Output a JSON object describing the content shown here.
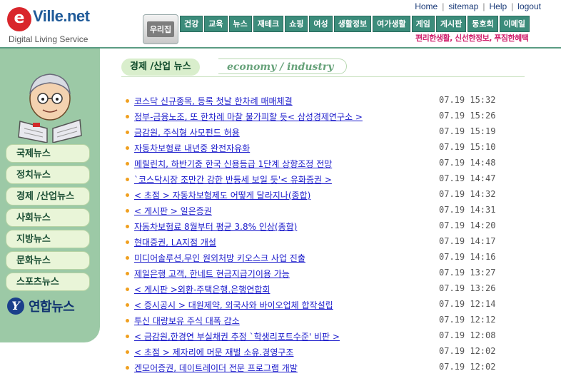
{
  "logo": {
    "e": "e",
    "name": "Ville.net",
    "tagline": "Digital Living Service"
  },
  "top_links": [
    "Home",
    "sitemap",
    "Help",
    "logout"
  ],
  "home_tab": "우리집",
  "nav_items": [
    "건강",
    "교육",
    "뉴스",
    "재테크",
    "쇼핑",
    "여성",
    "생활정보",
    "여가생활",
    "게임",
    "게시판",
    "동호회",
    "이메일"
  ],
  "slogan": "편리한생활, 신선한정보, 푸짐한혜택",
  "sidebar": {
    "items": [
      "국제뉴스",
      "정치뉴스",
      "경제 /산업뉴스",
      "사회뉴스",
      "지방뉴스",
      "문화뉴스",
      "스포츠뉴스"
    ],
    "brand": "연합뉴스"
  },
  "section": {
    "title_ko": "경제 /산업 뉴스",
    "title_en": "economy / industry"
  },
  "colors": {
    "accent": "#3c8c7b",
    "sidebar": "#9cc9a6",
    "link": "#1a1acb",
    "bullet": "#f0a020"
  },
  "news": [
    {
      "title": "코스닥 신규종목, 등록 첫날 한차례 매매체결",
      "time": "07.19 15:32"
    },
    {
      "title": "정부-금융노조, 또 한차례 마찰 불가피할 듯< 삼성경제연구소 >",
      "time": "07.19 15:26"
    },
    {
      "title": "금감원, 주식형 사모펀드 허용",
      "time": "07.19 15:19"
    },
    {
      "title": "자동차보험료 내년중 완전자유화",
      "time": "07.19 15:10"
    },
    {
      "title": "메릴린치, 하반기중 한국 신용등급 1단계 상향조정 전망",
      "time": "07.19 14:48"
    },
    {
      "title": "`코스닥시장 조만간 강한 반등세 보일 듯'< 유화증권 >",
      "time": "07.19 14:47"
    },
    {
      "title": "< 초점 > 자동차보험제도 어떻게 달라지나(종합)",
      "time": "07.19 14:32"
    },
    {
      "title": "< 게시판 > 일은증권",
      "time": "07.19 14:31"
    },
    {
      "title": "자동차보험료 8월부터 평균 3.8% 인상(종합)",
      "time": "07.19 14:20"
    },
    {
      "title": "현대증권, LA지점 개설",
      "time": "07.19 14:17"
    },
    {
      "title": "미디어솔루션,무인 원외처방 키오스크 사업 진출",
      "time": "07.19 14:16"
    },
    {
      "title": "제일은행 고객, 한네트 현금지급기이용 가능",
      "time": "07.19 13:27"
    },
    {
      "title": "< 게시판 >외환-주택은행.은행연합회",
      "time": "07.19 13:26"
    },
    {
      "title": "< 증시공시 > 대원제약, 외국사와 바이오업체 합작설립",
      "time": "07.19 12:14"
    },
    {
      "title": "투신 대량보유 주식 대폭 감소",
      "time": "07.19 12:12"
    },
    {
      "title": "< 금감원,한경연 부실채권 추정 `학생리포트수준' 비판 >",
      "time": "07.19 12:08"
    },
    {
      "title": "< 초점 > 제자리에 머문 재벌 소유.경영구조",
      "time": "07.19 12:02"
    },
    {
      "title": "겐모어증권, 데이트레이더 전문 프로그램 개발",
      "time": "07.19 12:02"
    }
  ]
}
